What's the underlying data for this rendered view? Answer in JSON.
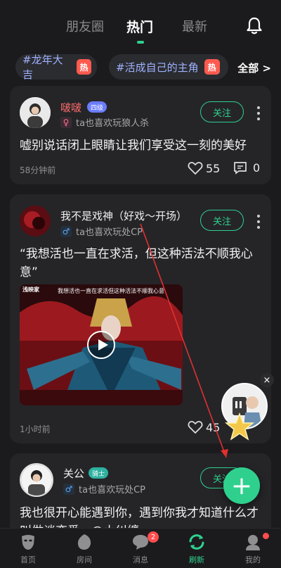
{
  "tabs": [
    "朋友圈",
    "热门",
    "最新"
  ],
  "active_tab": "热门",
  "topics": [
    {
      "label": "#龙年大吉",
      "hot": "热"
    },
    {
      "label": "#活成自己的主角",
      "hot": "热"
    }
  ],
  "topics_all": "全部 >",
  "posts": [
    {
      "username": "啵啵",
      "level_badge": "四级",
      "gender": "♀",
      "subtitle": "ta也喜欢玩狼人杀",
      "follow": "关注",
      "text": "嘘别说话闭上眼睛让我们享受这一刻的美好",
      "time": "58分钟前",
      "likes": "55",
      "comments": "0"
    },
    {
      "username": "我不是戏神（好戏～开场）",
      "gender": "♂",
      "subtitle": "ta也喜欢玩处CP",
      "follow": "关注",
      "text": "“我想活也一直在求活，但这种活法不顺我心意”",
      "video_caption": "我想活也一直在求活但这种活法不顺我心意",
      "video_logo": "浅映家",
      "time": "1小时前",
      "likes": "45"
    },
    {
      "username": "关公",
      "level_badge": "骑士",
      "gender": "♂",
      "subtitle": "ta也喜欢玩处CP",
      "follow": "关注",
      "text": "我也很开心能遇到你，遇到你我才知道什么才叫做谈恋爱。@小纠缠"
    }
  ],
  "float_close": "×",
  "fab_label": "+",
  "nav": [
    {
      "label": "首页",
      "icon": "home-mask-icon"
    },
    {
      "label": "房间",
      "icon": "room-icon"
    },
    {
      "label": "消息",
      "icon": "message-icon",
      "badge": "2"
    },
    {
      "label": "刷新",
      "icon": "refresh-icon"
    },
    {
      "label": "我的",
      "icon": "profile-icon"
    }
  ],
  "colors": {
    "accent": "#2fd08e",
    "hot": "#ff5a4f",
    "background": "#1b1b1d",
    "card": "#252528"
  }
}
